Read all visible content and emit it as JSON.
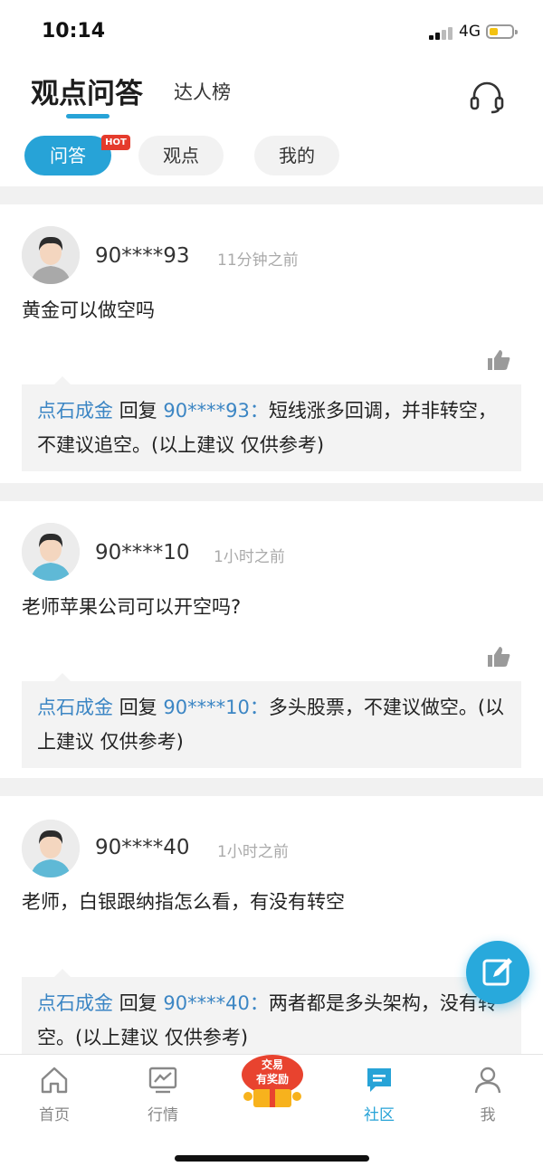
{
  "status": {
    "time": "10:14",
    "network": "4G"
  },
  "nav": {
    "title": "观点问答",
    "tab2": "达人榜",
    "headset_icon": "headset-icon"
  },
  "filters": {
    "items": [
      "问答",
      "观点",
      "我的"
    ],
    "hot_badge": "HOT",
    "active": "问答"
  },
  "posts": [
    {
      "user": "90****93",
      "time": "11分钟之前",
      "question": "黄金可以做空吗",
      "reply": {
        "author": "点石成金",
        "verb": "回复",
        "target": "90****93：",
        "text": "短线涨多回调，并非转空，不建议追空。(以上建议 仅供参考)"
      }
    },
    {
      "user": "90****10",
      "time": "1小时之前",
      "question": "老师苹果公司可以开空吗?",
      "reply": {
        "author": "点石成金",
        "verb": "回复",
        "target": "90****10：",
        "text": "多头股票，不建议做空。(以上建议 仅供参考)"
      }
    },
    {
      "user": "90****40",
      "time": "1小时之前",
      "question": "老师，白银跟纳指怎么看，有没有转空",
      "reply": {
        "author": "点石成金",
        "verb": "回复",
        "target": "90****40：",
        "text": "两者都是多头架构，没有转空。(以上建议 仅供参考)"
      }
    }
  ],
  "promo": {
    "line1": "交易",
    "line2": "有奖励"
  },
  "tabbar": {
    "items": [
      {
        "label": "首页",
        "icon": "home-icon"
      },
      {
        "label": "行情",
        "icon": "chart-icon"
      },
      {
        "label": "社区",
        "icon": "chat-icon"
      },
      {
        "label": "我",
        "icon": "person-icon"
      }
    ],
    "active": "社区"
  },
  "colors": {
    "accent": "#27a3d7",
    "link": "#3c86c4",
    "hot": "#e53b2c"
  }
}
